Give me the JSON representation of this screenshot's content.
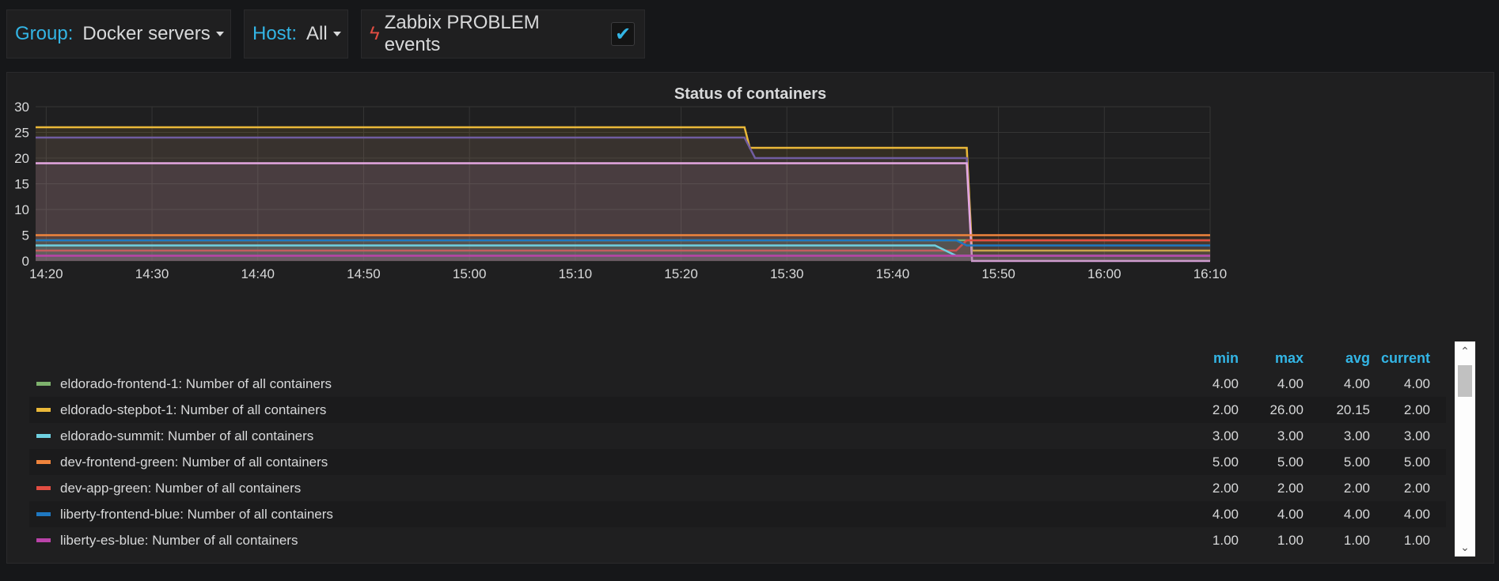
{
  "variables": {
    "group": {
      "label": "Group:",
      "value": "Docker servers"
    },
    "host": {
      "label": "Host:",
      "value": "All"
    },
    "annotation": {
      "label": "Zabbix PROBLEM events",
      "checked": true
    }
  },
  "panel": {
    "title": "Status of containers"
  },
  "chart_data": {
    "type": "line",
    "title": "Status of containers",
    "x_ticks": [
      "14:20",
      "14:30",
      "14:40",
      "14:50",
      "15:00",
      "15:10",
      "15:20",
      "15:30",
      "15:40",
      "15:50",
      "16:00",
      "16:10"
    ],
    "x_range": [
      "14:19",
      "16:10"
    ],
    "y_ticks": [
      "0",
      "5",
      "10",
      "15",
      "20",
      "25",
      "30"
    ],
    "ylim": [
      0,
      30
    ],
    "grid": true,
    "legend_placement": "bottom-table",
    "legend_columns": [
      "min",
      "max",
      "avg",
      "current"
    ],
    "series": [
      {
        "name": "eldorado-frontend-1: Number of all containers",
        "color": "#7eb26d",
        "points": [
          [
            "14:19",
            4
          ],
          [
            "15:46",
            4
          ],
          [
            "15:47",
            4
          ],
          [
            "16:10",
            4
          ]
        ],
        "stats": {
          "min": "4.00",
          "max": "4.00",
          "avg": "4.00",
          "current": "4.00"
        }
      },
      {
        "name": "eldorado-stepbot-1: Number of all containers",
        "color": "#eab839",
        "points": [
          [
            "14:19",
            26
          ],
          [
            "15:26",
            26
          ],
          [
            "15:26.5",
            22
          ],
          [
            "15:47",
            22
          ],
          [
            "15:47.5",
            2
          ],
          [
            "16:10",
            2
          ]
        ],
        "stats": {
          "min": "2.00",
          "max": "26.00",
          "avg": "20.15",
          "current": "2.00"
        }
      },
      {
        "name": "eldorado-summit: Number of all containers",
        "color": "#6ed0e0",
        "points": [
          [
            "14:19",
            3
          ],
          [
            "15:44",
            3
          ],
          [
            "15:46",
            1
          ],
          [
            "16:10",
            1
          ]
        ],
        "stats": {
          "min": "3.00",
          "max": "3.00",
          "avg": "3.00",
          "current": "3.00"
        }
      },
      {
        "name": "dev-frontend-green: Number of all containers",
        "color": "#ef843c",
        "points": [
          [
            "14:19",
            5
          ],
          [
            "16:10",
            5
          ]
        ],
        "stats": {
          "min": "5.00",
          "max": "5.00",
          "avg": "5.00",
          "current": "5.00"
        }
      },
      {
        "name": "dev-app-green: Number of all containers",
        "color": "#e24d42",
        "points": [
          [
            "14:19",
            2
          ],
          [
            "15:46",
            2
          ],
          [
            "15:47",
            4
          ],
          [
            "16:10",
            4
          ]
        ],
        "stats": {
          "min": "2.00",
          "max": "2.00",
          "avg": "2.00",
          "current": "2.00"
        }
      },
      {
        "name": "liberty-frontend-blue: Number of all containers",
        "color": "#1f78c1",
        "points": [
          [
            "14:19",
            4
          ],
          [
            "15:46",
            4
          ],
          [
            "15:47",
            3
          ],
          [
            "16:10",
            3
          ]
        ],
        "stats": {
          "min": "4.00",
          "max": "4.00",
          "avg": "4.00",
          "current": "4.00"
        }
      },
      {
        "name": "liberty-es-blue: Number of all containers",
        "color": "#ba43a9",
        "points": [
          [
            "14:19",
            1
          ],
          [
            "16:10",
            1
          ]
        ],
        "stats": {
          "min": "1.00",
          "max": "1.00",
          "avg": "1.00",
          "current": "1.00"
        }
      },
      {
        "name": "",
        "color": "#705da0",
        "points": [
          [
            "14:19",
            24
          ],
          [
            "15:26",
            24
          ],
          [
            "15:27",
            20
          ],
          [
            "15:47",
            20
          ],
          [
            "15:47.5",
            0
          ],
          [
            "16:10",
            0
          ]
        ]
      },
      {
        "name": "",
        "color": "#e5a8e2",
        "points": [
          [
            "14:19",
            19
          ],
          [
            "15:47",
            19
          ],
          [
            "15:47.5",
            0
          ],
          [
            "16:10",
            0
          ]
        ]
      }
    ]
  }
}
